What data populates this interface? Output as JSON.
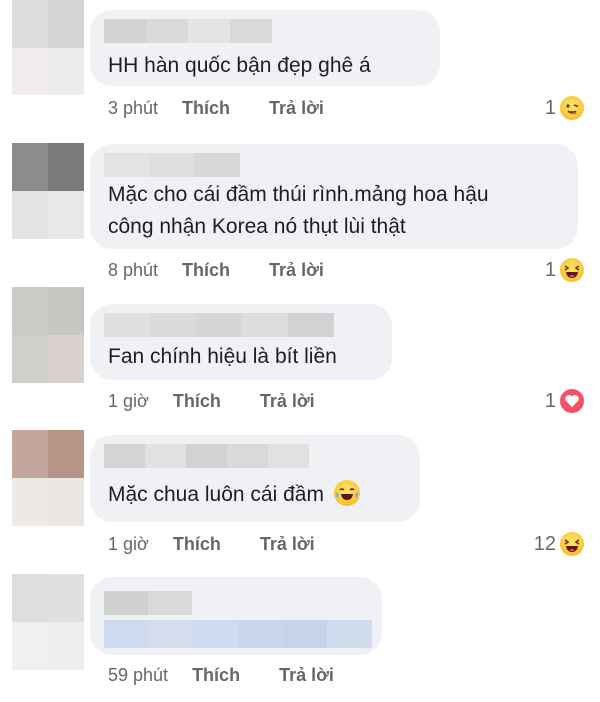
{
  "comments": [
    {
      "text_lines": [
        "HH hàn quốc bận đẹp ghê á"
      ],
      "time": "3 phút",
      "like_label": "Thích",
      "reply_label": "Trả lời",
      "reaction_count": "1",
      "reaction_icon": "yum-face-icon"
    },
    {
      "text_lines": [
        "Mặc cho cái đầm thúi rình.mảng hoa hậu",
        "công nhận Korea nó thụt lùi thật"
      ],
      "time": "8 phút",
      "like_label": "Thích",
      "reply_label": "Trả lời",
      "reaction_count": "1",
      "reaction_icon": "haha-icon"
    },
    {
      "text_lines": [
        "Fan chính hiệu là bít liền"
      ],
      "time": "1 giờ",
      "like_label": "Thích",
      "reply_label": "Trả lời",
      "reaction_count": "1",
      "reaction_icon": "love-icon"
    },
    {
      "text_lines": [
        "Mặc chua luôn cái đầm"
      ],
      "time": "1 giờ",
      "like_label": "Thích",
      "reply_label": "Trả lời",
      "reaction_count": "12",
      "reaction_icon": "haha-icon",
      "inline_emoji": "tears-of-joy-icon"
    },
    {
      "text_lines": [],
      "time": "59 phút",
      "like_label": "Thích",
      "reply_label": "Trả lời",
      "reaction_count": "",
      "reaction_icon": ""
    }
  ],
  "colors": {
    "bubble": "#eff1f4",
    "meta_text": "#65676b",
    "body_text": "#1c1e21",
    "love": "#f25268",
    "emoji_yellow": "#f6b21a"
  }
}
